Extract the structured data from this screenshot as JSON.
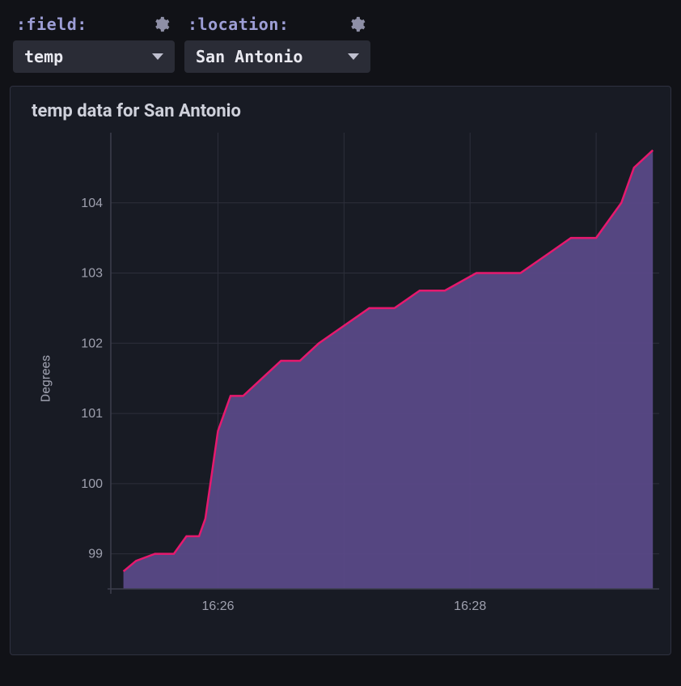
{
  "toolbar": {
    "field": {
      "name": ":field:",
      "value": "temp"
    },
    "location": {
      "name": ":location:",
      "value": "San Antonio"
    }
  },
  "panel": {
    "title": "temp data for San Antonio",
    "ylabel": "Degrees"
  },
  "chart_data": {
    "type": "area",
    "title": "temp data for San Antonio",
    "xlabel": "",
    "ylabel": "Degrees",
    "x_ticks": [
      "16:26",
      "16:28"
    ],
    "y_ticks": [
      99,
      100,
      101,
      102,
      103,
      104
    ],
    "ylim": [
      98.5,
      105
    ],
    "series": [
      {
        "name": "temp",
        "color": "#e6196e",
        "fill": "#5b4a8a",
        "x_minutes": [
          25.25,
          25.35,
          25.5,
          25.65,
          25.75,
          25.85,
          25.9,
          26.0,
          26.1,
          26.2,
          26.35,
          26.5,
          26.65,
          26.8,
          27.0,
          27.2,
          27.4,
          27.6,
          27.8,
          28.05,
          28.25,
          28.4,
          28.6,
          28.8,
          29.0,
          29.2,
          29.3,
          29.45
        ],
        "values": [
          98.75,
          98.9,
          99.0,
          99.0,
          99.25,
          99.25,
          99.5,
          100.75,
          101.25,
          101.25,
          101.5,
          101.75,
          101.75,
          102.0,
          102.25,
          102.5,
          102.5,
          102.75,
          102.75,
          103.0,
          103.0,
          103.0,
          103.25,
          103.5,
          103.5,
          104.0,
          104.5,
          104.75
        ]
      }
    ],
    "xlim_minutes": [
      25.15,
      29.5
    ]
  },
  "colors": {
    "line": "#e6196e",
    "fill": "#5b4a8a",
    "grid": "#2d2f3b",
    "bg": "#181b24"
  }
}
